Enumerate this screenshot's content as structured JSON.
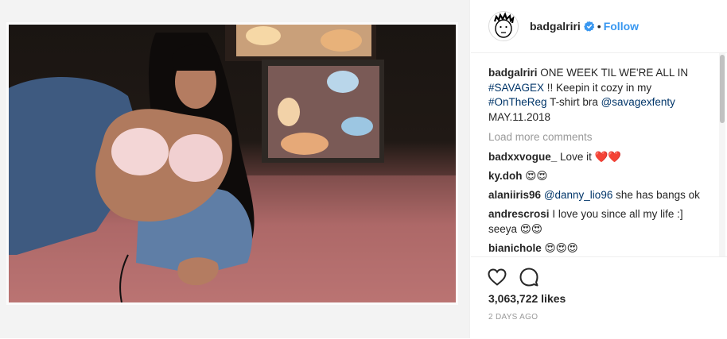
{
  "colors": {
    "link": "#003569",
    "follow": "#3897f0",
    "verified": "#3897f0",
    "muted": "#999999"
  },
  "post": {
    "image_alt": "Polaroid photo of a woman in a pink bra and denim jacket lying on a pink carpet in front of two glowing TV screens"
  },
  "header": {
    "username": "badgalriri",
    "verified_icon": "verified-badge-icon",
    "separator": "•",
    "follow_label": "Follow"
  },
  "caption": {
    "username": "badgalriri",
    "text_1": "ONE WEEK TIL WE'RE ALL IN",
    "hashtag_1": "#SAVAGEX",
    "text_2": "!! Keepin it cozy in my",
    "hashtag_2": "#OnTheReg",
    "text_3": "T-shirt bra",
    "mention": "@savagexfenty",
    "date": "MAY.11.2018"
  },
  "load_more": "Load more comments",
  "comments": [
    {
      "user": "badxxvogue_",
      "text": "Love it ❤️❤️"
    },
    {
      "user": "ky.doh",
      "text": "😍😍"
    },
    {
      "user": "alaniiris96",
      "mention": "@danny_lio96",
      "text": "she has bangs ok"
    },
    {
      "user": "andrescrosi",
      "text": "I love you since all my life :]"
    },
    {
      "user": "",
      "text": "seeya 😍😍"
    },
    {
      "user": "bianichole",
      "text": "😍😍😍"
    }
  ],
  "actions": {
    "like_icon": "heart-icon",
    "comment_icon": "comment-bubble-icon"
  },
  "likes": "3,063,722 likes",
  "time": "2 DAYS AGO"
}
